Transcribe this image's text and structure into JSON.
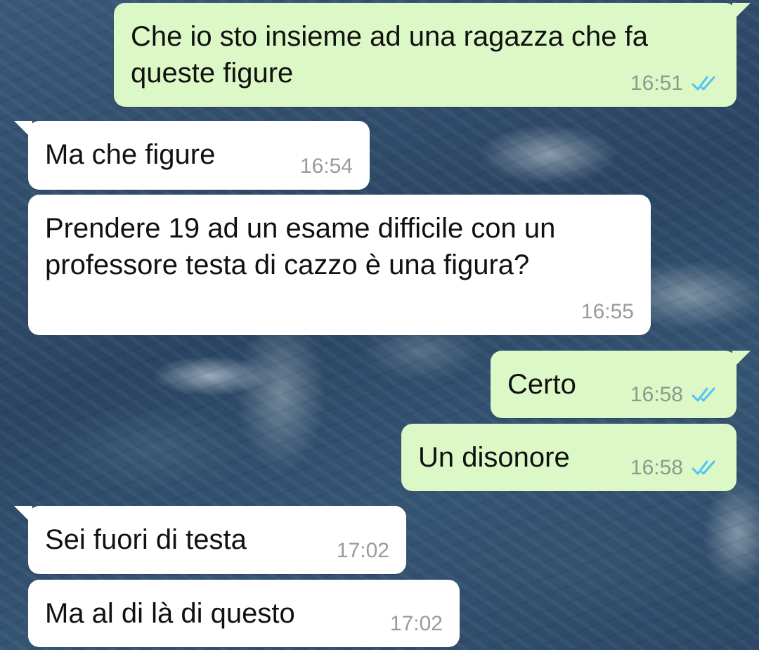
{
  "messages": [
    {
      "direction": "out",
      "text": "Che io sto insieme ad una ragazza che fa\nqueste figure",
      "time": "16:51",
      "status": "read-double-check-icon"
    },
    {
      "direction": "in",
      "text": "Ma che figure",
      "time": "16:54"
    },
    {
      "direction": "in",
      "text": "Prendere 19 ad un esame difficile con un\nprofessore testa di cazzo è una figura?",
      "time": "16:55"
    },
    {
      "direction": "out",
      "text": "Certo",
      "time": "16:58",
      "status": "read-double-check-icon"
    },
    {
      "direction": "out",
      "text": "Un disonore",
      "time": "16:58",
      "status": "read-double-check-icon"
    },
    {
      "direction": "in",
      "text": "Sei fuori di testa",
      "time": "17:02"
    },
    {
      "direction": "in",
      "text": "Ma al di là di questo",
      "time": "17:02"
    }
  ],
  "colors": {
    "outgoing_bubble": "#dcf8c6",
    "incoming_bubble": "#ffffff",
    "read_ticks": "#4fc3f7",
    "wallpaper": "#2f4a66"
  }
}
